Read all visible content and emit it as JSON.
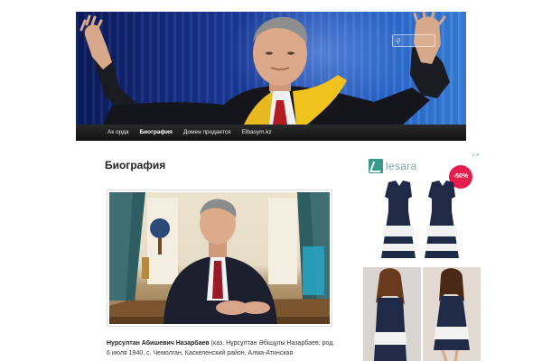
{
  "header": {
    "search": {
      "placeholder": ""
    }
  },
  "nav": {
    "items": [
      {
        "label": "Ак орда"
      },
      {
        "label": "Биография",
        "active": true
      },
      {
        "label": "Домен продается"
      },
      {
        "label": "Elbasym.kz"
      }
    ]
  },
  "page": {
    "title": "Биография",
    "bio_name": "Нурсултан Абишевич Назарбаев",
    "bio_text": " (каз. Нұрсұлтан Әбішұлы Назарбаев; род. 6 июля 1940, с. Чемолган, Каскеленский район, Алма-Атинская"
  },
  "ad": {
    "brand": "lesara",
    "discount_badge": "-50%",
    "colors": {
      "badge": "#e41e4c",
      "logo": "#3a9a8a"
    }
  },
  "icons": {
    "search": "magnifier-icon",
    "ad_close": "ad-close-icon"
  }
}
